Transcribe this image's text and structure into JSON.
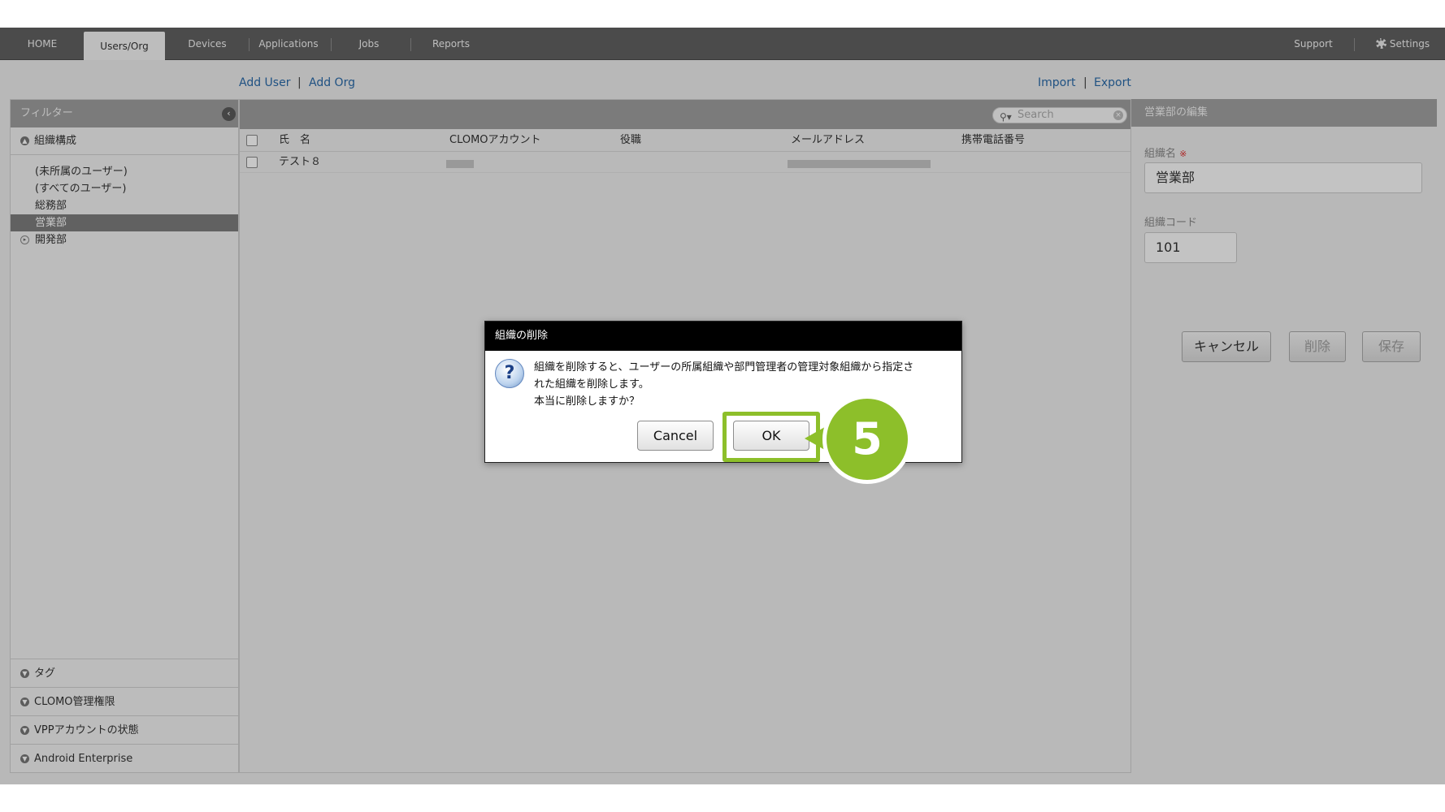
{
  "nav": {
    "tabs": [
      "HOME",
      "Users/Org",
      "Devices",
      "Applications",
      "Jobs",
      "Reports"
    ],
    "active_tab": "Users/Org",
    "support": "Support",
    "settings": "Settings"
  },
  "actions": {
    "add_user": "Add User",
    "add_org": "Add Org",
    "import": "Import",
    "export": "Export",
    "separator": "|"
  },
  "sidebar": {
    "filter_title": "フィルター",
    "org_section": "組織構成",
    "org_items": [
      "(未所属のユーザー)",
      "(すべてのユーザー)",
      "総務部",
      "営業部",
      "開発部"
    ],
    "selected_org": "営業部",
    "bottom_sections": [
      "タグ",
      "CLOMO管理権限",
      "VPPアカウントの状態",
      "Android Enterprise"
    ]
  },
  "table": {
    "search_placeholder": "Search",
    "columns": [
      "氏　名",
      "CLOMOアカウント",
      "役職",
      "メールアドレス",
      "携帯電話番号"
    ],
    "rows": [
      {
        "name": "テスト８"
      }
    ]
  },
  "edit_panel": {
    "title": "営業部の編集",
    "org_name_label": "組織名",
    "required_mark": "※",
    "org_name_value": "営業部",
    "org_code_label": "組織コード",
    "org_code_value": "101",
    "cancel": "キャンセル",
    "delete": "削除",
    "save": "保存"
  },
  "dialog": {
    "title": "組織の削除",
    "message_line1": "組織を削除すると、ユーザーの所属組織や部門管理者の管理対象組織から指定さ",
    "message_line2": "れた組織を削除します。",
    "message_line3": "本当に削除しますか？",
    "cancel": "Cancel",
    "ok": "OK"
  },
  "annotation": {
    "step": "5",
    "accent": "#8dbf2a"
  }
}
